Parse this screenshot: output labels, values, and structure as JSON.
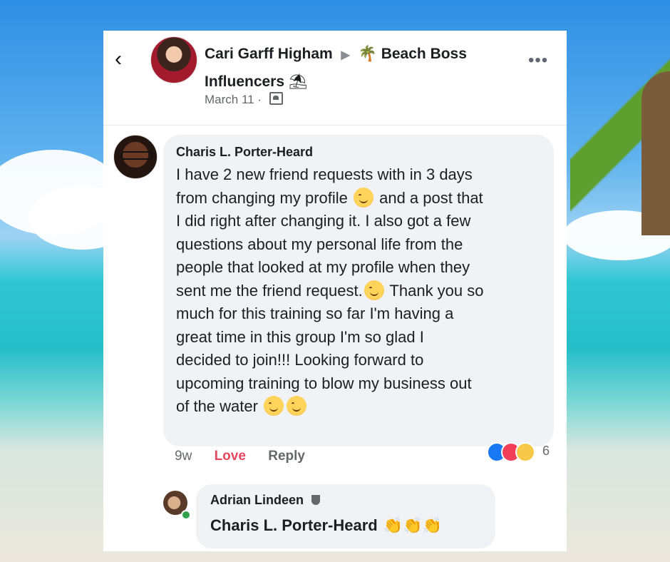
{
  "post": {
    "author": "Cari Garff Higham",
    "arrow": "▶",
    "group_emoji": "🌴",
    "group_name": "Beach Boss Influencers",
    "group_emoji_after": "⛱",
    "date": "March 11 ·",
    "back_icon": "chevron-left-icon",
    "more_label": "•••"
  },
  "comment": {
    "author": "Charis L. Porter-Heard",
    "text_part1": "I have 2 new friend requests with in 3 days\nfrom changing my profile ",
    "text_part2": " and a post that\nI did right after changing it. I also got a few\nquestions about my personal life from the\npeople that looked at my profile when they\nsent me the friend request.",
    "text_part3": " Thank you so\nmuch for this training so far I'm having a\ngreat time in this group I'm so glad I\ndecided to join!!! Looking forward to\nupcoming training to blow my business out\nof the water ",
    "time": "9w",
    "love": "Love",
    "reply": "Reply",
    "reaction_count": "6"
  },
  "reply": {
    "author": "Adrian Lindeen",
    "text": "Charis L. Porter-Heard",
    "claps": "👏👏👏"
  },
  "colors": {
    "love": "#e4495f",
    "like": "#1877f2",
    "online": "#31a24c"
  }
}
